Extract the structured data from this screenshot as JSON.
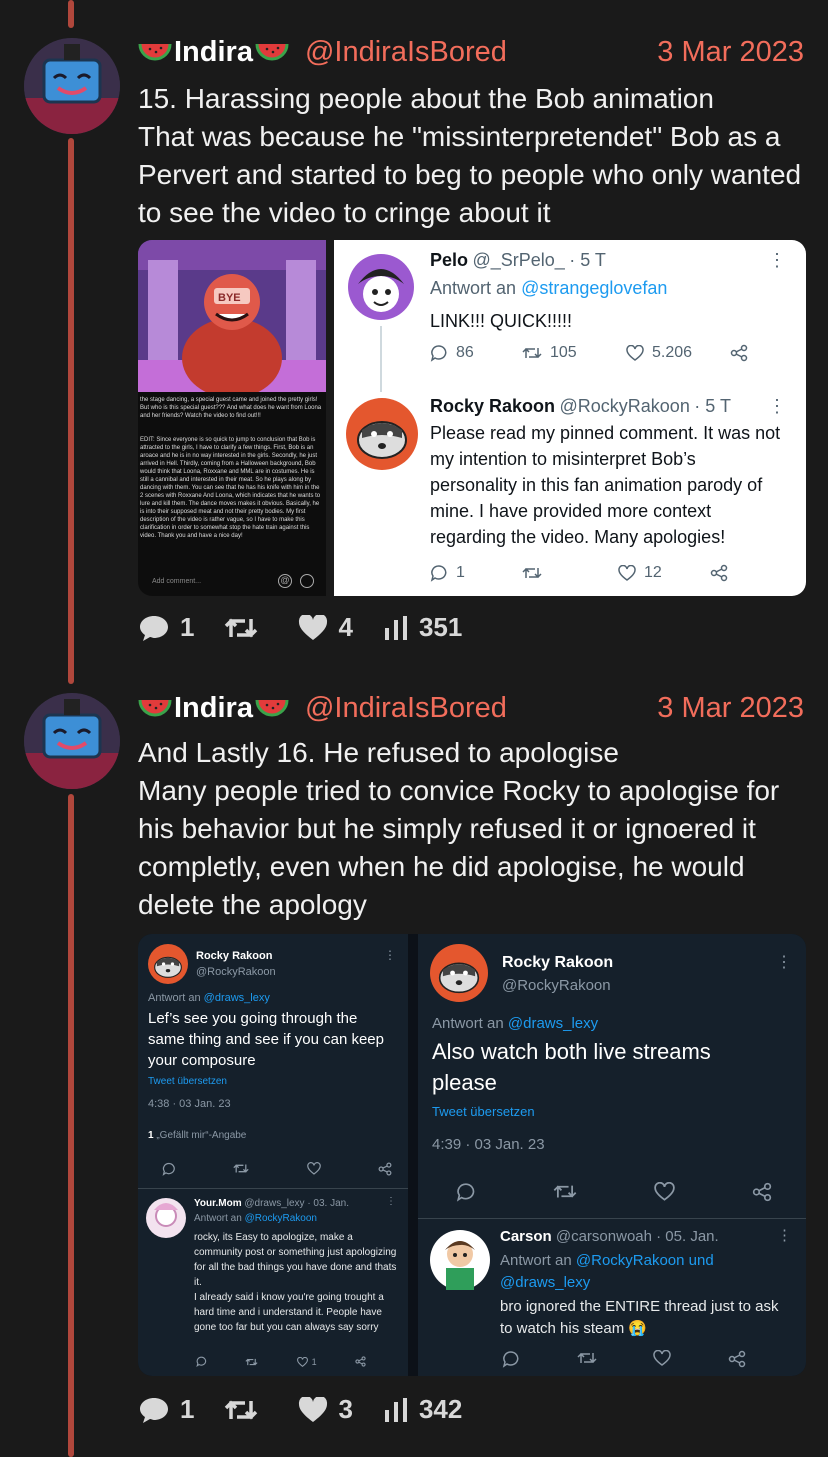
{
  "posts": [
    {
      "author_name": "Indira",
      "handle": "@IndiraIsBored",
      "date": "3 Mar 2023",
      "text": "15. Harassing people about the Bob animation\nThat was because he \"missinterpretendet\" Bob as a Pervert and started to beg to people who only wanted to see the video to cringe about it",
      "stats": {
        "replies": "1",
        "reposts": "",
        "likes": "4",
        "views": "351"
      }
    },
    {
      "author_name": "Indira",
      "handle": "@IndiraIsBored",
      "date": "3 Mar 2023",
      "text": "And Lastly 16. He refused to apologise\nMany people tried to convice Rocky to apologise for his behavior but he simply refused it or ignoered it completly, even when he did apologise, he would delete the apology",
      "stats": {
        "replies": "1",
        "reposts": "",
        "likes": "3",
        "views": "342"
      }
    }
  ],
  "media1": {
    "left_screenshot": {
      "badge": "BYE",
      "description": "the stage dancing, a special guest came and joined the pretty girls! But who is this special guest??? And what does he want from Loona and her friends? Watch the video to find out!!!",
      "edit": "EDIT: Since everyone is so quick to jump to conclusion that Bob is attracted to the girls, I have to clarify a few things. First, Bob is an aroace and he is in no way interested in the girls. Secondly, he just arrived in Hell. Thirdly, coming from a Halloween background, Bob would think that Loona, Roxxane and MML are in costumes. He is still a cannibal and interested in their meat. So he plays along by dancing with them. You can see that he has his knife with him in the 2 scenes with Roxxane And Loona, which indicates that he wants to lure and kill them. The dance moves makes it obvious. Basically, he is into their supposed meat and not their pretty bodies. My first description of the video is rather vague, so I have to make this clarification in order to somewhat stop the hate train against this video. Thank you and have a nice day!",
      "comment_placeholder": "Add comment..."
    },
    "tweet1": {
      "name": "Pelo",
      "handle": "@_SrPelo_",
      "time": "· 5 T",
      "reply_prefix": "Antwort an",
      "reply_to": "@strangeglovefan",
      "text": "LINK!!! QUICK!!!!!",
      "replies": "86",
      "retweets": "105",
      "likes": "5.206"
    },
    "tweet2": {
      "name": "Rocky Rakoon",
      "handle": "@RockyRakoon",
      "time": "· 5 T",
      "text": "Please read my pinned comment. It was not my intention to misinterpret Bob’s personality in this fan animation parody of mine. I have provided more context regarding the video. Many apologies!",
      "replies": "1",
      "retweets": "",
      "likes": "12"
    }
  },
  "media2": {
    "left": {
      "name": "Rocky Rakoon",
      "handle": "@RockyRakoon",
      "reply_prefix": "Antwort an",
      "reply_to": "@draws_lexy",
      "text": "Lef’s see you going through the same thing and see if you can keep your composure",
      "translate": "Tweet übersetzen",
      "timestamp": "4:38 · 03 Jan. 23",
      "likes_count": "1",
      "likes_label": "„Gefällt mir“-Angabe",
      "reply": {
        "name": "Your.Mom",
        "handle": "@draws_lexy",
        "time": "· 03. Jan.",
        "reply_prefix": "Antwort an",
        "reply_to": "@RockyRakoon",
        "text1": "rocky, its Easy to apologize, make a community post or something just apologizing for all the bad things you have done and thats it.",
        "text2": "I already said i know you're going trought a hard time and i understand it. People have gone too far but you can always say sorry",
        "likes": "1"
      }
    },
    "right": {
      "name": "Rocky Rakoon",
      "handle": "@RockyRakoon",
      "reply_prefix": "Antwort an",
      "reply_to": "@draws_lexy",
      "text": "Also watch both live streams please",
      "translate": "Tweet übersetzen",
      "timestamp": "4:39 · 03 Jan. 23",
      "reply": {
        "name": "Carson",
        "handle": "@carsonwoah",
        "time": "· 05. Jan.",
        "reply_prefix": "Antwort an",
        "reply_to": "@RockyRakoon und @draws_lexy",
        "text": "bro ignored the ENTIRE thread just to ask to watch his steam 😭"
      }
    }
  },
  "colors": {
    "accent": "#f26d5b",
    "thread": "#b0473c",
    "link": "#1d9bf0"
  }
}
